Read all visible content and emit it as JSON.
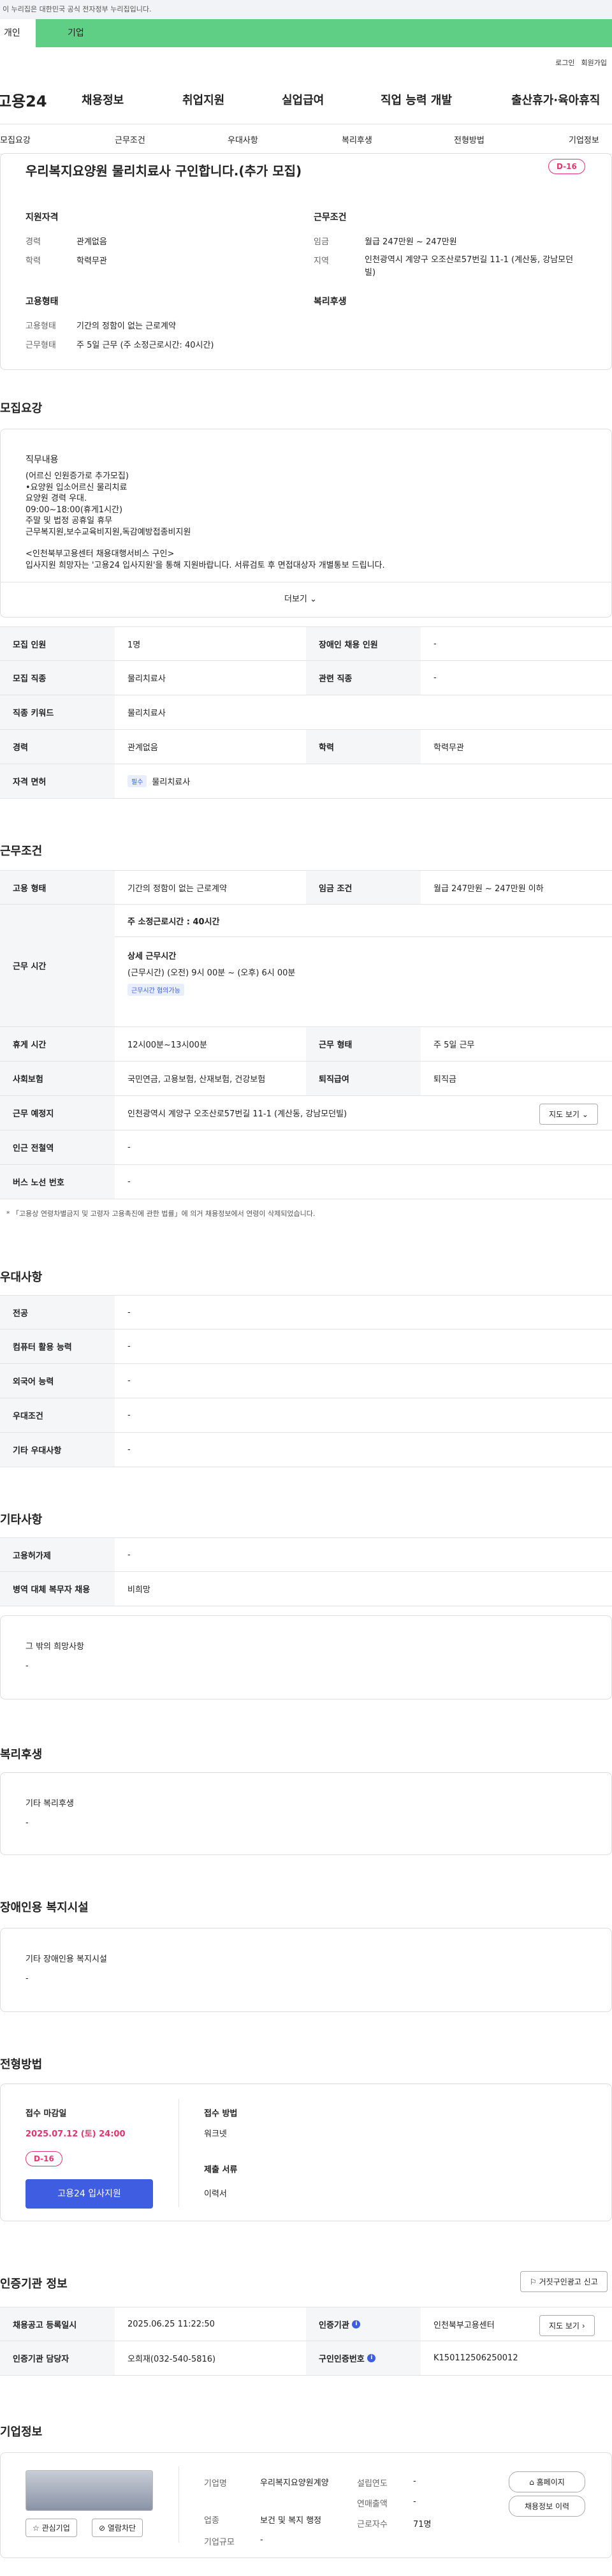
{
  "gov_banner": "이 누리집은 대한민국 공식 전자정부 누리집입니다.",
  "tabs": {
    "individual": "개인",
    "business": "기업"
  },
  "top_links": {
    "login": "로그인",
    "join": "회원가입"
  },
  "logo": "고용24",
  "gnb": [
    "채용정보",
    "취업지원",
    "실업급여",
    "직업 능력 개발",
    "출산휴가·육아휴직"
  ],
  "subnav": [
    "모집요강",
    "근무조건",
    "우대사항",
    "복리후생",
    "전형방법",
    "기업정보"
  ],
  "job": {
    "title": "우리복지요양원 물리치료사 구인합니다.(추가 모집)",
    "dday": "D-16"
  },
  "summary": {
    "qual_title": "지원자격",
    "career_lbl": "경력",
    "career": "관계없음",
    "edu_lbl": "학력",
    "edu": "학력무관",
    "cond_title": "근무조건",
    "wage_lbl": "임금",
    "wage": "월급 247만원 ~ 247만원",
    "loc_lbl": "지역",
    "loc": "인천광역시 계양구 오조산로57번길 11-1 (계산동, 강남모던빌)",
    "emp_title": "고용형태",
    "emptype_lbl": "고용형태",
    "emptype": "기간의 정함이 없는 근로계약",
    "worktype_lbl": "근무형태",
    "worktype": "주 5일 근무 (주 소정근로시간: 40시간)",
    "welfare_title": "복리후생"
  },
  "recruit": {
    "section": "모집요강",
    "desc_title": "직무내용",
    "desc": [
      "(어르신 인원증가로 추가모집)",
      "•요양원 입소어르신 물리치료",
      "요양원 경력 우대.",
      "09:00~18:00(휴게1시간)",
      "주말 및 법정 공휴일 휴무",
      "근무복지원,보수교육비지원,독감예방접종비지원",
      "",
      "<인천북부고용센터 채용대행서비스 구인>",
      "입사지원 희망자는 '고용24 입사지원'을 통해 지원바랍니다. 서류검토 후 면접대상자 개별통보 드립니다."
    ],
    "more": "더보기",
    "rows": [
      {
        "h1": "모집 인원",
        "v1": "1명",
        "h2": "장애인 채용 인원",
        "v2": "-"
      },
      {
        "h1": "모집 직종",
        "v1": "물리치료사",
        "h2": "관련 직종",
        "v2": "-"
      },
      {
        "h1": "직종 키워드",
        "v1": "물리치료사"
      },
      {
        "h1": "경력",
        "v1": "관계없음",
        "h2": "학력",
        "v2": "학력무관"
      },
      {
        "h1": "자격 면허",
        "chip": "필수",
        "v1": "물리치료사"
      }
    ]
  },
  "cond": {
    "section": "근무조건",
    "emp_h": "고용 형태",
    "emp_v": "기간의 정함이 없는 근로계약",
    "wage_h": "임금 조건",
    "wage_v": "월급 247만원 ~ 247만원 이하",
    "hours_h": "근무 시간",
    "hours_total": "주 소정근로시간 : 40시간",
    "hours_detail_t": "상세 근무시간",
    "hours_detail": "(근무시간) (오전) 9시 00분 ~ (오후) 6시 00분",
    "hours_chip": "근무시간 협의가능",
    "rest_h": "휴게 시간",
    "rest_v": "12시00분~13시00분",
    "shift_h": "근무 형태",
    "shift_v": "주 5일 근무",
    "ins_h": "사회보험",
    "ins_v": "국민연금, 고용보험, 산재보험, 건강보험",
    "sev_h": "퇴직급여",
    "sev_v": "퇴직금",
    "place_h": "근무 예정지",
    "place_v": "인천광역시 계양구 오조산로57번길 11-1 (계산동, 강남모던빌)",
    "map_btn": "지도 보기",
    "station_h": "인근 전철역",
    "station_v": "-",
    "bus_h": "버스 노선 번호",
    "bus_v": "-",
    "notice": "* 「고용상 연령차별금지 및 고령자 고용촉진에 관한 법률」에 의거 채용정보에서 연령이 삭제되었습니다."
  },
  "pref": {
    "section": "우대사항",
    "rows": [
      {
        "h": "전공",
        "v": "-"
      },
      {
        "h": "컴퓨터 활용 능력",
        "v": "-"
      },
      {
        "h": "외국어 능력",
        "v": "-"
      },
      {
        "h": "우대조건",
        "v": "-"
      },
      {
        "h": "기타 우대사항",
        "v": "-"
      }
    ]
  },
  "etc": {
    "section": "기타사항",
    "rows": [
      {
        "h": "고용허가제",
        "v": "-"
      },
      {
        "h": "병역 대체 복무자 채용",
        "v": "비희망"
      }
    ],
    "other_t": "그 밖의 희망사항",
    "other_v": "-"
  },
  "welfare": {
    "section": "복리후생",
    "t": "기타 복리후생",
    "v": "-"
  },
  "disabled": {
    "section": "장애인용 복지시설",
    "t": "기타 장애인용 복지시설",
    "v": "-"
  },
  "process": {
    "section": "전형방법",
    "deadline_t": "접수 마감일",
    "deadline": "2025.07.12 (토) 24:00",
    "dday": "D-16",
    "apply_btn": "고용24 입사지원",
    "method_t": "접수 방법",
    "method_v": "워크넷",
    "docs_t": "제출 서류",
    "docs_v": "이력서"
  },
  "cert": {
    "section": "인증기관 정보",
    "report_btn": "거짓구인광고 신고",
    "reg_h": "채용공고 등록일시",
    "reg_v": "2025.06.25 11:22:50",
    "org_h": "인증기관",
    "org_v": "인천북부고용센터",
    "map_btn": "지도 보기",
    "mgr_h": "인증기관 담당자",
    "mgr_v": "오희재(032-540-5816)",
    "no_h": "구인인증번호",
    "no_v": "K150112506250012"
  },
  "company": {
    "section": "기업정보",
    "name_l": "기업명",
    "name_v": "우리복지요양원계양",
    "ind_l": "업종",
    "ind_v": "보건 및 복지 행정",
    "size_l": "기업규모",
    "size_v": "-",
    "year_l": "설립연도",
    "year_v": "-",
    "sales_l": "연매출액",
    "sales_v": "-",
    "emp_l": "근로자수",
    "emp_v": "71명",
    "home_btn": "홈페이지",
    "other_btn": "채용정보 이력",
    "fav_btn": "관심기업",
    "block_btn": "열람차단"
  }
}
